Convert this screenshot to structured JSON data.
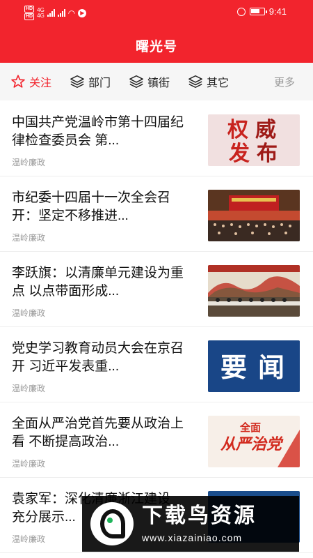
{
  "status": {
    "time": "9:41",
    "network": "4G",
    "hd_label": "HD"
  },
  "header": {
    "title": "曙光号"
  },
  "tabs": [
    {
      "label": "关注",
      "icon": "star-icon",
      "active": true
    },
    {
      "label": "部门",
      "icon": "layers-icon",
      "active": false
    },
    {
      "label": "镇街",
      "icon": "layers-icon",
      "active": false
    },
    {
      "label": "其它",
      "icon": "layers-icon",
      "active": false
    }
  ],
  "more_label": "更多",
  "articles": [
    {
      "title": "中国共产党温岭市第十四届纪律检查委员会 第...",
      "source": "温岭廉政",
      "thumb_text": "权威 发布"
    },
    {
      "title": "市纪委十四届十一次全会召开：坚定不移推进...",
      "source": "温岭廉政"
    },
    {
      "title": "李跃旗：以清廉单元建设为重点 以点带面形成...",
      "source": "温岭廉政"
    },
    {
      "title": "党史学习教育动员大会在京召开 习近平发表重...",
      "source": "温岭廉政",
      "thumb_text": "要闻"
    },
    {
      "title": "全面从严治党首先要从政治上看 不断提高政治...",
      "source": "温岭廉政",
      "thumb_text": "全面从严治党"
    },
    {
      "title": "袁家军：深化清廉浙江建设 充分展示...",
      "source": "温岭廉政"
    }
  ],
  "watermark": {
    "brand": "下载鸟资源",
    "url": "www.xiazainiao.com"
  },
  "colors": {
    "brand_red": "#f2242d",
    "text": "#111111",
    "muted": "#999999"
  }
}
